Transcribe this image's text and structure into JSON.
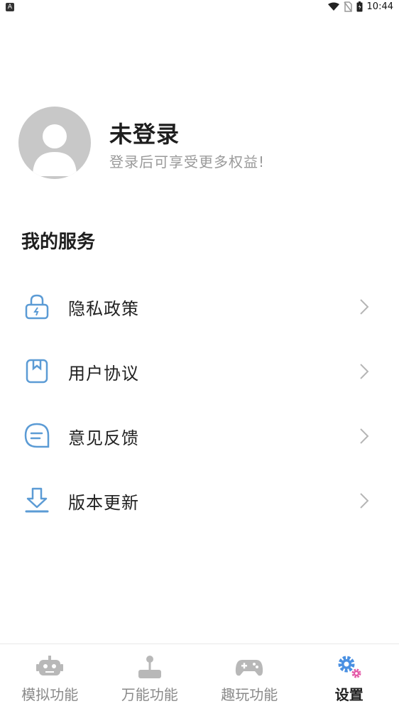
{
  "status": {
    "time": "10:44",
    "battery": "",
    "app_glyph": "A"
  },
  "profile": {
    "name": "未登录",
    "subtitle": "登录后可享受更多权益!"
  },
  "services": {
    "title": "我的服务",
    "items": [
      {
        "label": "隐私政策",
        "icon": "lock-icon"
      },
      {
        "label": "用户协议",
        "icon": "bookmark-icon"
      },
      {
        "label": "意见反馈",
        "icon": "chat-bubble-icon"
      },
      {
        "label": "版本更新",
        "icon": "download-icon"
      }
    ]
  },
  "tabs": [
    {
      "label": "模拟功能",
      "icon": "robot-icon",
      "active": false
    },
    {
      "label": "万能功能",
      "icon": "joystick-icon",
      "active": false
    },
    {
      "label": "趣玩功能",
      "icon": "gamepad-icon",
      "active": false
    },
    {
      "label": "设置",
      "icon": "gear-icon",
      "active": true
    }
  ],
  "colors": {
    "accent": "#5b9bd5",
    "muted": "#c8c8c8",
    "gear_secondary": "#e45aa8"
  }
}
